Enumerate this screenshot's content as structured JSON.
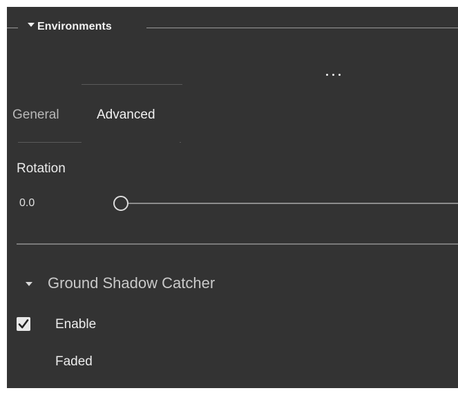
{
  "section": {
    "title": "Environments"
  },
  "more": {
    "icon": "ellipsis-icon"
  },
  "tabs": [
    {
      "label": "General",
      "active": false
    },
    {
      "label": "Advanced",
      "active": true
    }
  ],
  "rotation": {
    "label": "Rotation",
    "value": "0.0",
    "slider_value": 0
  },
  "ground_shadow": {
    "title": "Ground Shadow Catcher",
    "enable_label": "Enable",
    "enable_checked": true,
    "faded_label": "Faded"
  },
  "colors": {
    "panel_bg": "#333333",
    "text": "#e6e6e6"
  }
}
